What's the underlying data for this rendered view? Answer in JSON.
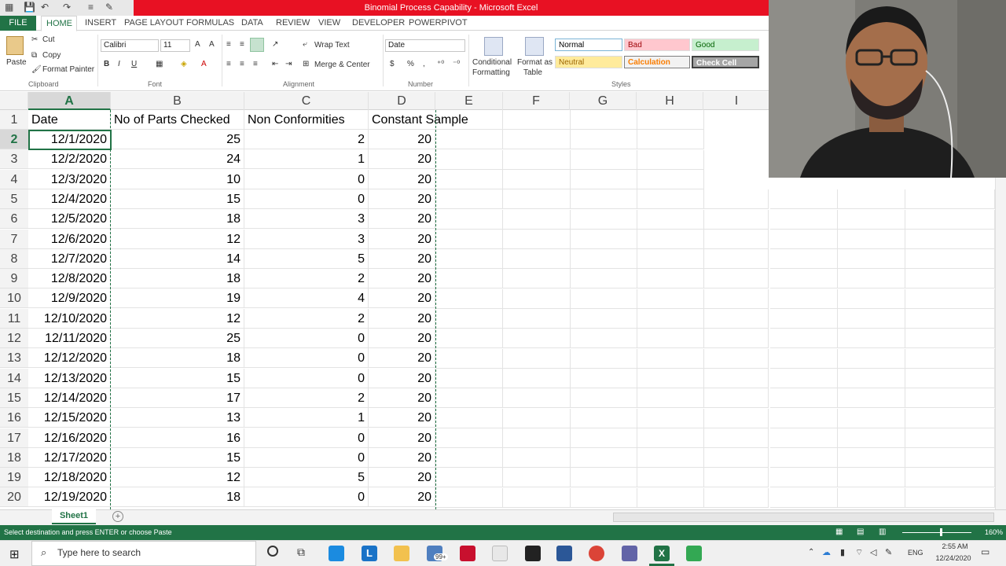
{
  "window": {
    "title": "Binomial Process Capability - Microsoft Excel"
  },
  "tabs": [
    "FILE",
    "HOME",
    "INSERT",
    "PAGE LAYOUT",
    "FORMULAS",
    "DATA",
    "REVIEW",
    "VIEW",
    "DEVELOPER",
    "POWERPIVOT"
  ],
  "ribbon": {
    "paste": "Paste",
    "cut": "Cut",
    "copy": "Copy",
    "format_painter": "Format Painter",
    "clipboard": "Clipboard",
    "font_name": "Calibri",
    "font_size": "11",
    "font_group": "Font",
    "wrap_text": "Wrap Text",
    "merge_center": "Merge & Center",
    "alignment": "Alignment",
    "number_format": "Date",
    "number": "Number",
    "conditional_formatting_1": "Conditional",
    "conditional_formatting_2": "Formatting",
    "format_as_table_1": "Format as",
    "format_as_table_2": "Table",
    "styles_group": "Styles",
    "styles": {
      "normal": "Normal",
      "bad": "Bad",
      "good": "Good",
      "neutral": "Neutral",
      "calculation": "Calculation",
      "check_cell": "Check Cell"
    }
  },
  "grid": {
    "columns": [
      "A",
      "B",
      "C",
      "D",
      "E",
      "F",
      "G",
      "H",
      "I"
    ],
    "headers": [
      "Date",
      "No of Parts Checked",
      "Non Conformities",
      "Constant Sample"
    ],
    "rows": [
      {
        "n": "2",
        "a": "12/1/2020",
        "b": "25",
        "c": "2",
        "d": "20"
      },
      {
        "n": "3",
        "a": "12/2/2020",
        "b": "24",
        "c": "1",
        "d": "20"
      },
      {
        "n": "4",
        "a": "12/3/2020",
        "b": "10",
        "c": "0",
        "d": "20"
      },
      {
        "n": "5",
        "a": "12/4/2020",
        "b": "15",
        "c": "0",
        "d": "20"
      },
      {
        "n": "6",
        "a": "12/5/2020",
        "b": "18",
        "c": "3",
        "d": "20"
      },
      {
        "n": "7",
        "a": "12/6/2020",
        "b": "12",
        "c": "3",
        "d": "20"
      },
      {
        "n": "8",
        "a": "12/7/2020",
        "b": "14",
        "c": "5",
        "d": "20"
      },
      {
        "n": "9",
        "a": "12/8/2020",
        "b": "18",
        "c": "2",
        "d": "20"
      },
      {
        "n": "10",
        "a": "12/9/2020",
        "b": "19",
        "c": "4",
        "d": "20"
      },
      {
        "n": "11",
        "a": "12/10/2020",
        "b": "12",
        "c": "2",
        "d": "20"
      },
      {
        "n": "12",
        "a": "12/11/2020",
        "b": "25",
        "c": "0",
        "d": "20"
      },
      {
        "n": "13",
        "a": "12/12/2020",
        "b": "18",
        "c": "0",
        "d": "20"
      },
      {
        "n": "14",
        "a": "12/13/2020",
        "b": "15",
        "c": "0",
        "d": "20"
      },
      {
        "n": "15",
        "a": "12/14/2020",
        "b": "17",
        "c": "2",
        "d": "20"
      },
      {
        "n": "16",
        "a": "12/15/2020",
        "b": "13",
        "c": "1",
        "d": "20"
      },
      {
        "n": "17",
        "a": "12/16/2020",
        "b": "16",
        "c": "0",
        "d": "20"
      },
      {
        "n": "18",
        "a": "12/17/2020",
        "b": "15",
        "c": "0",
        "d": "20"
      },
      {
        "n": "19",
        "a": "12/18/2020",
        "b": "12",
        "c": "5",
        "d": "20"
      },
      {
        "n": "20",
        "a": "12/19/2020",
        "b": "18",
        "c": "0",
        "d": "20"
      }
    ]
  },
  "sheet_tab": "Sheet1",
  "status": {
    "message": "Select destination and press ENTER or choose Paste",
    "zoom": "160%"
  },
  "taskbar": {
    "search": "Type here to search",
    "lang": "ENG",
    "time": "2:55 AM",
    "date": "12/24/2020",
    "badge": "99+"
  },
  "colors": {
    "excel_green": "#217346",
    "title_red": "#e81123"
  }
}
